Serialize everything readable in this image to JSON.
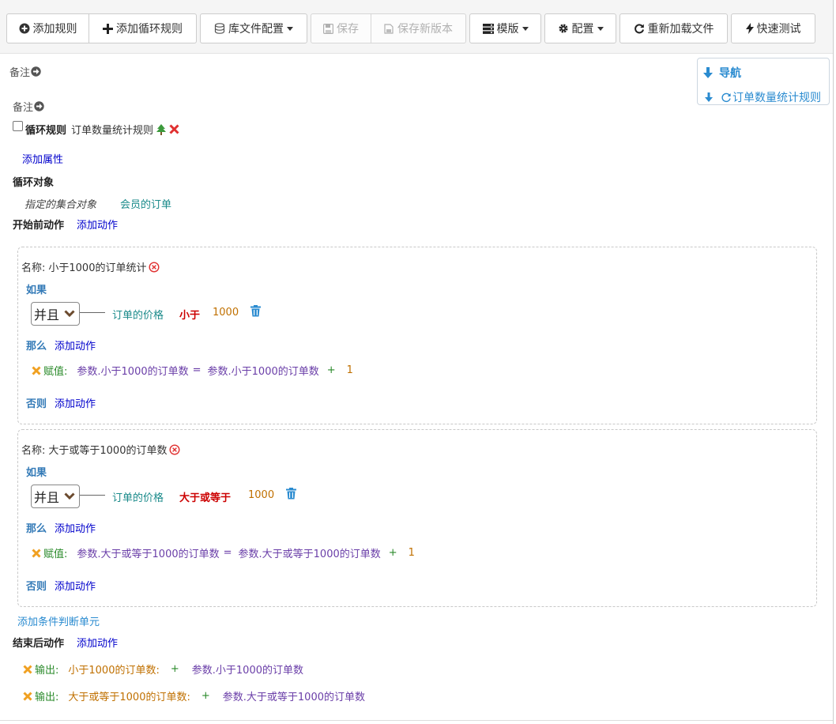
{
  "toolbar": {
    "add_rule": "添加规则",
    "add_loop_rule": "添加循环规则",
    "lib_config": "库文件配置",
    "save": "保存",
    "save_new_version": "保存新版本",
    "template": "模版",
    "config": "配置",
    "reload_file": "重新加载文件",
    "quick_test": "快速测试"
  },
  "nav": {
    "title": "导航",
    "item": "订单数量统计规则"
  },
  "remark_top": "备注",
  "remark_rule": "备注",
  "rule": {
    "type_label": "循环规则",
    "name": "订单数量统计规则",
    "add_property": "添加属性",
    "loop_object_label": "循环对象",
    "loop_object_key": "指定的集合对象",
    "loop_object_value": "会员的订单",
    "before_action_label": "开始前动作",
    "add_action": "添加动作"
  },
  "units": [
    {
      "name_label": "名称:",
      "name": "小于1000的订单统计",
      "if_label": "如果",
      "logic": "并且",
      "condition_field": "订单的价格",
      "operator": "小于",
      "value": "1000",
      "then_label": "那么",
      "add_action": "添加动作",
      "action_type": "赋值:",
      "target": "参数.小于1000的订单数",
      "equals": "=",
      "source": "参数.小于1000的订单数",
      "plus": "+",
      "increment": "1",
      "else_label": "否则",
      "else_add_action": "添加动作"
    },
    {
      "name_label": "名称:",
      "name": "大于或等于1000的订单数",
      "if_label": "如果",
      "logic": "并且",
      "condition_field": "订单的价格",
      "operator": "大于或等于",
      "value": "1000",
      "then_label": "那么",
      "add_action": "添加动作",
      "action_type": "赋值:",
      "target": "参数.大于或等于1000的订单数",
      "equals": "=",
      "source": "参数.大于或等于1000的订单数",
      "plus": "+",
      "increment": "1",
      "else_label": "否则",
      "else_add_action": "添加动作"
    }
  ],
  "add_condition_unit": "添加条件判断单元",
  "after": {
    "label": "结束后动作",
    "add_action": "添加动作",
    "outputs": [
      {
        "type": "输出:",
        "label": "小于1000的订单数:",
        "plus": "+",
        "param": "参数.小于1000的订单数"
      },
      {
        "type": "输出:",
        "label": "大于或等于1000的订单数:",
        "plus": "+",
        "param": "参数.大于或等于1000的订单数"
      }
    ]
  }
}
